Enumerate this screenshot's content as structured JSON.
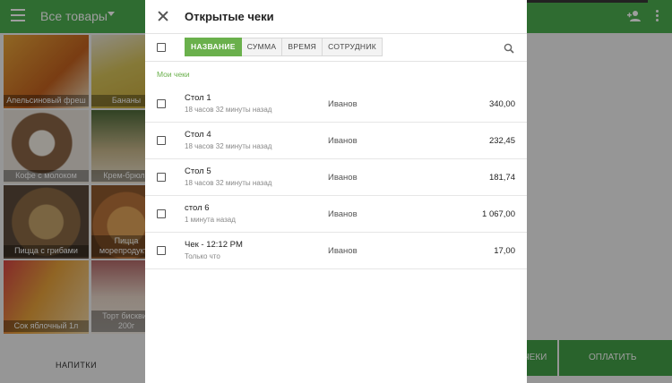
{
  "app": {
    "title": "Все товары",
    "products": [
      {
        "label": "Апельсиновый фреш",
        "color": "#d98b2a"
      },
      {
        "label": "Бананы",
        "color": "#c9b048"
      },
      {
        "label": "Кофе с молоком",
        "color": "#7a5a3e"
      },
      {
        "label": "Крем-брюле",
        "color": "#9b8f6c"
      },
      {
        "label": "Пицца с грибами",
        "color": "#7e6a4c"
      },
      {
        "label": "Пицца морепродукты",
        "color": "#b07a3f"
      },
      {
        "label": "Сок яблочный 1л",
        "color": "#c98a3a"
      },
      {
        "label": "Торт бисквит 200г",
        "color": "#b5868a"
      }
    ],
    "bottom_tab": "НАПИТКИ",
    "buttons": {
      "checks": "ЧЕКИ",
      "pay": "ОПЛАТИТЬ"
    },
    "accent": "#4caf50"
  },
  "dialog": {
    "title": "Открытые чеки",
    "tabs": [
      "НАЗВАНИЕ",
      "СУММА",
      "ВРЕМЯ",
      "СОТРУДНИК"
    ],
    "active_tab": "НАЗВАНИЕ",
    "section_label": "Мои чеки",
    "receipts": [
      {
        "name": "Стол 1",
        "time": "18 часов 32 минуты назад",
        "employee": "Иванов",
        "sum": "340,00"
      },
      {
        "name": "Стол 4",
        "time": "18 часов 32 минуты назад",
        "employee": "Иванов",
        "sum": "232,45"
      },
      {
        "name": "Стол 5",
        "time": "18 часов 32 минуты назад",
        "employee": "Иванов",
        "sum": "181,74"
      },
      {
        "name": "стол 6",
        "time": "1 минута назад",
        "employee": "Иванов",
        "sum": "1 067,00"
      },
      {
        "name": "Чек - 12:12 PM",
        "time": "Только что",
        "employee": "Иванов",
        "sum": "17,00"
      }
    ],
    "accent": "#6ab04c"
  }
}
